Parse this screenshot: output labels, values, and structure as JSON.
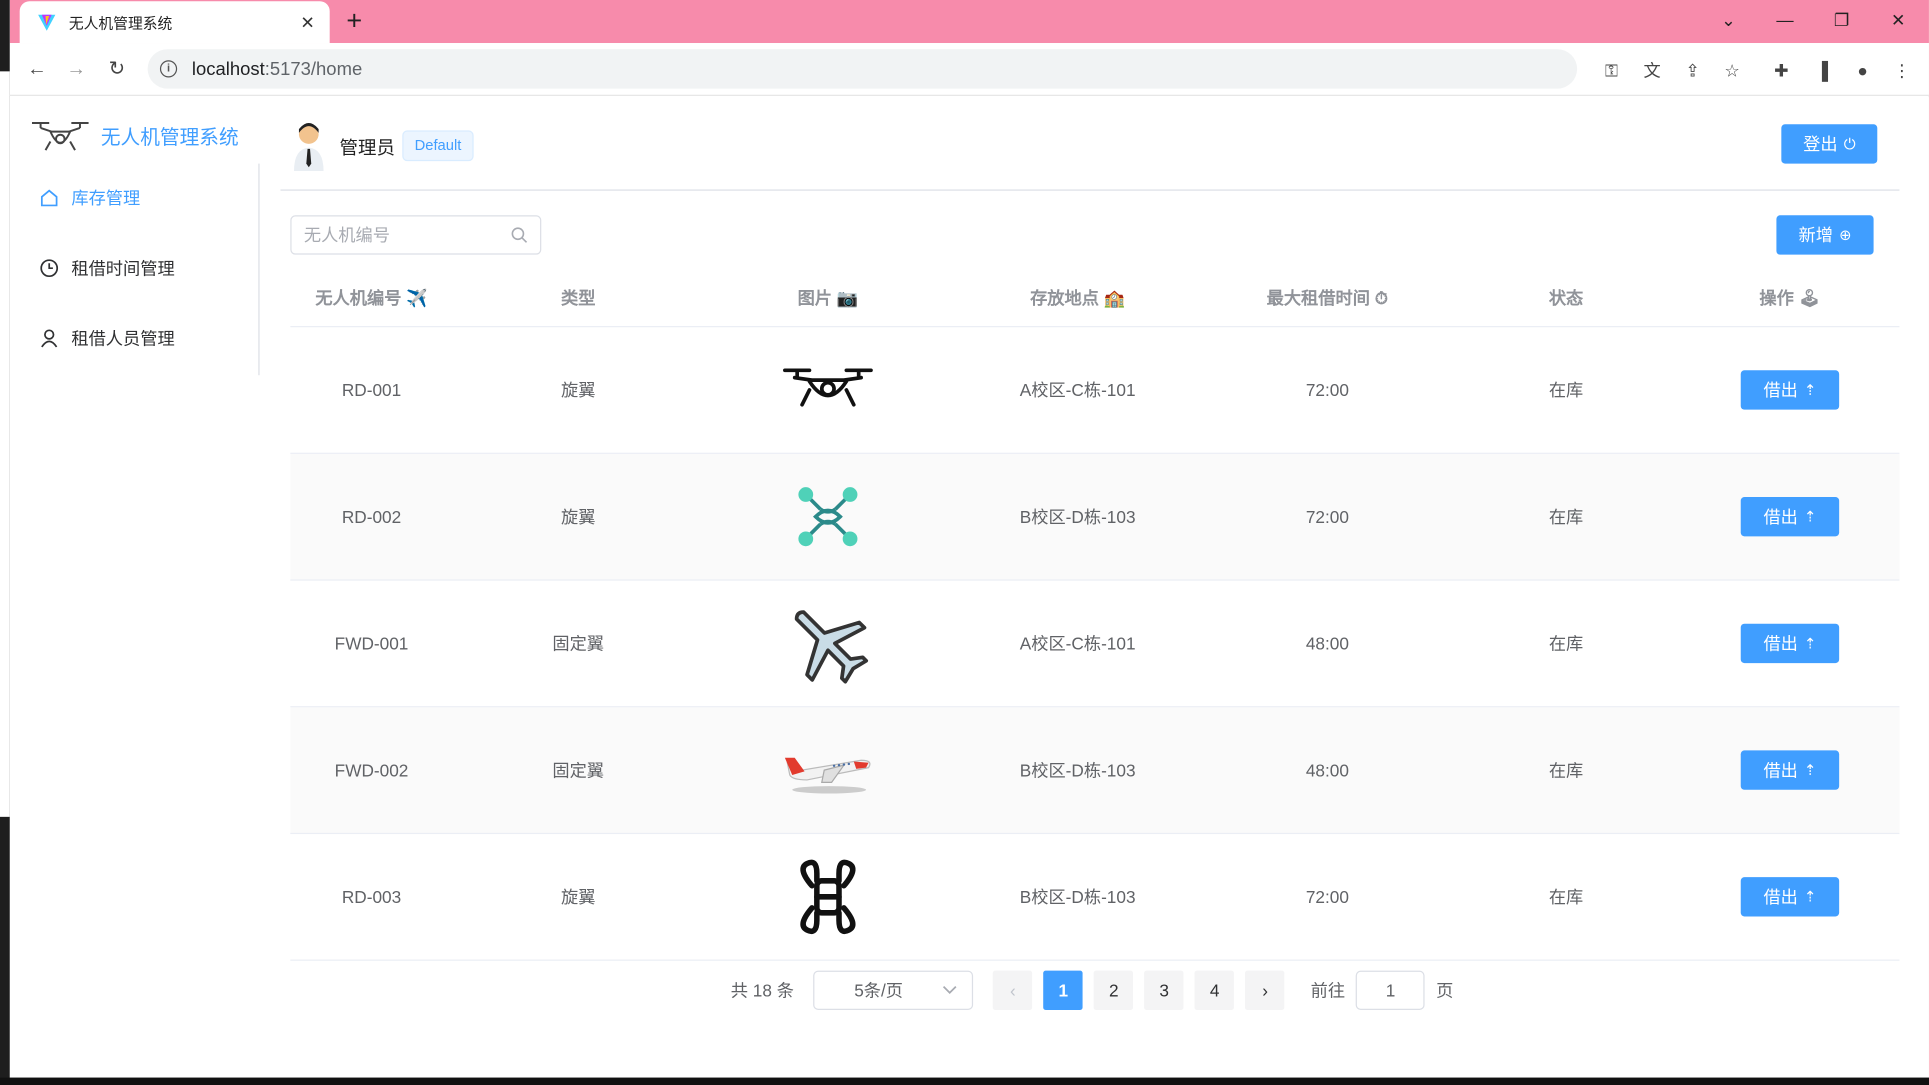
{
  "browser": {
    "tab_title": "无人机管理系统",
    "tab_close": "✕",
    "new_tab": "+",
    "url_host": "localhost",
    "url_path": ":5173/home"
  },
  "app": {
    "brand": "无人机管理系统",
    "menu": [
      {
        "label": "库存管理",
        "icon": "home-icon",
        "active": true
      },
      {
        "label": "租借时间管理",
        "icon": "clock-icon",
        "active": false
      },
      {
        "label": "租借人员管理",
        "icon": "user-icon",
        "active": false
      }
    ],
    "user_name": "管理员",
    "role_tag": "Default",
    "logout_label": "登出",
    "add_label": "新增",
    "search_placeholder": "无人机编号",
    "accent": "#409eff"
  },
  "table": {
    "headers": [
      "无人机编号 ✈️",
      "类型",
      "图片 📷",
      "存放地点 🏫",
      "最大租借时间 ⏱",
      "状态",
      "操作 🕹"
    ],
    "rows": [
      {
        "id": "RD-001",
        "type": "旋翼",
        "image": "quadcopter-icon",
        "location": "A校区-C栋-101",
        "max_time": "72:00",
        "status": "在库",
        "action": "借出"
      },
      {
        "id": "RD-002",
        "type": "旋翼",
        "image": "teal-drone-icon",
        "location": "B校区-D栋-103",
        "max_time": "72:00",
        "status": "在库",
        "action": "借出"
      },
      {
        "id": "FWD-001",
        "type": "固定翼",
        "image": "airplane-icon",
        "location": "A校区-C栋-101",
        "max_time": "48:00",
        "status": "在库",
        "action": "借出"
      },
      {
        "id": "FWD-002",
        "type": "固定翼",
        "image": "airliner-icon",
        "location": "B校区-D栋-103",
        "max_time": "48:00",
        "status": "在库",
        "action": "借出"
      },
      {
        "id": "RD-003",
        "type": "旋翼",
        "image": "outline-drone-icon",
        "location": "B校区-D栋-103",
        "max_time": "72:00",
        "status": "在库",
        "action": "借出"
      }
    ]
  },
  "pagination": {
    "total": "共 18 条",
    "page_size": "5条/页",
    "prev": "‹",
    "pages": [
      "1",
      "2",
      "3",
      "4"
    ],
    "current": "1",
    "next": "›",
    "goto_prefix": "前往",
    "goto_value": "1",
    "goto_suffix": "页"
  }
}
